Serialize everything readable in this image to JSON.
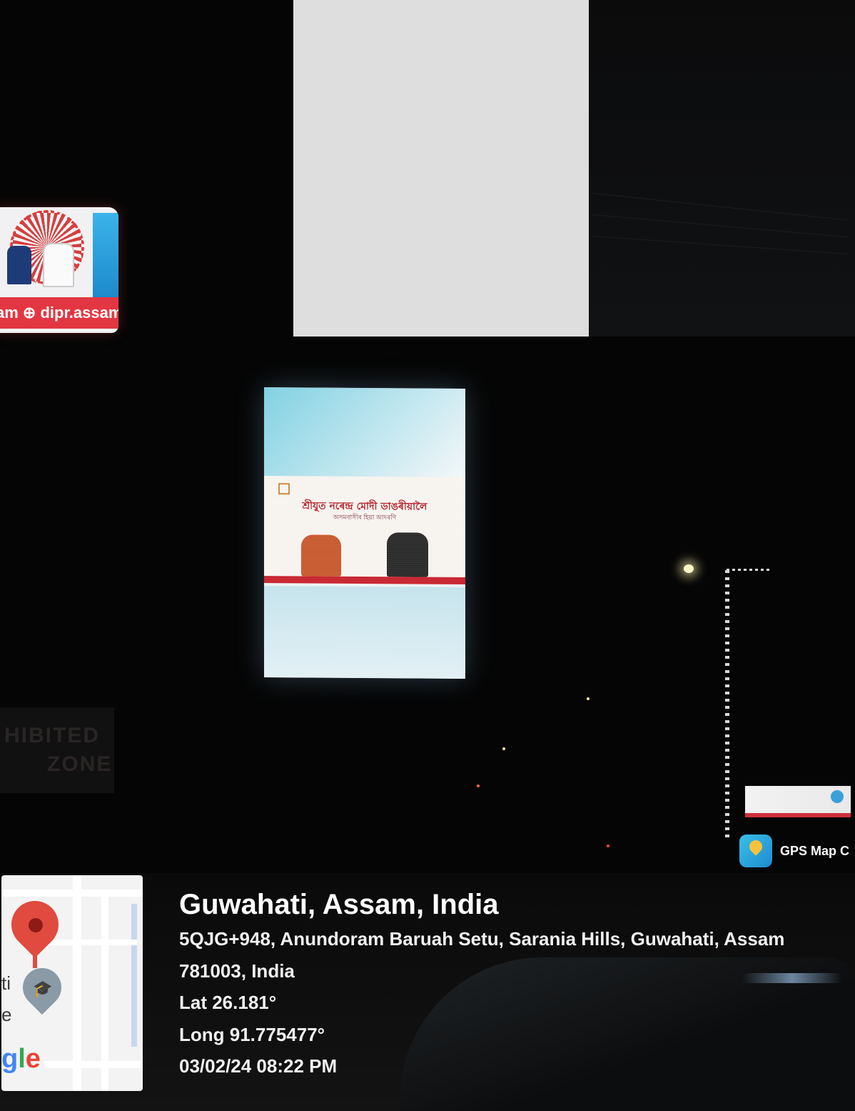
{
  "location": {
    "city_line": "Guwahati, Assam, India",
    "address_line1": "5QJG+948, Anundoram Baruah Setu, Sarania Hills, Guwahati, Assam",
    "address_line2": "781003, India",
    "latitude": "Lat 26.181°",
    "longitude": "Long 91.775477°",
    "timestamp": "03/02/24 08:22 PM"
  },
  "app_badge": {
    "label": "GPS Map C",
    "icon": "map-pin-icon"
  },
  "map_thumbnail": {
    "label_a": "ti",
    "label_b": "e",
    "brand_parts": [
      "g",
      "l",
      "e"
    ]
  },
  "billboards": {
    "left_banner_text": "am ⊕ dipr.assam.gov.in",
    "center_headline": "শ্ৰীযুত নৰেন্দ্ৰ মোদী ডাঙৰীয়ালৈ",
    "center_subline": "অসমবাসীৰ হিয়া আদৰণি"
  },
  "street_sign": {
    "line1": "HIBITED",
    "line2": "ZONE"
  },
  "colors": {
    "overlay_text": "#ffffff",
    "billboard_red": "#e23742",
    "map_pin": "#e04a3f"
  }
}
